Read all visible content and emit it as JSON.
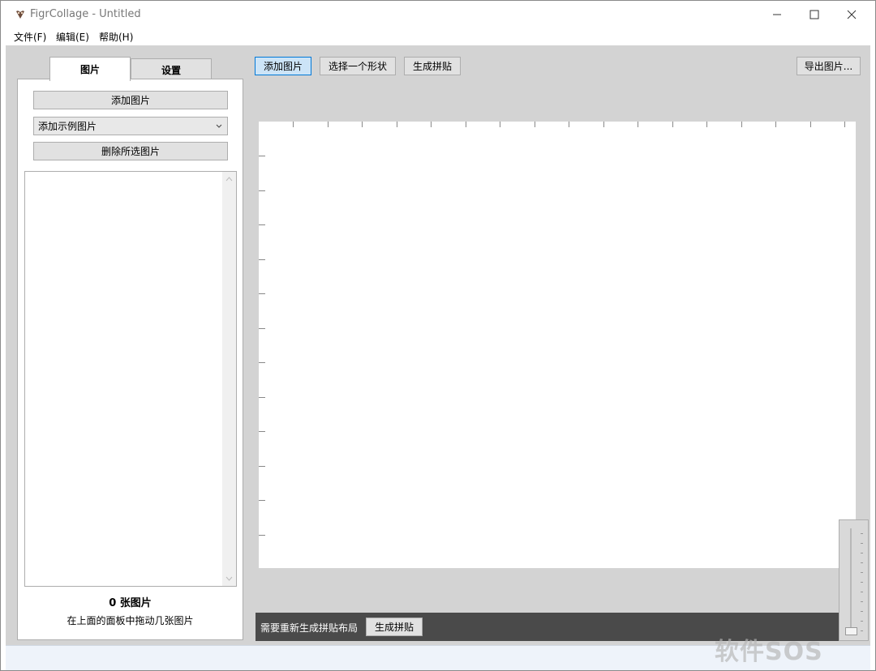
{
  "window": {
    "title": "FigrCollage - Untitled"
  },
  "menu": [
    {
      "label": "文件(F)"
    },
    {
      "label": "编辑(E)"
    },
    {
      "label": "帮助(H)"
    }
  ],
  "tabs": [
    {
      "label": "图片"
    },
    {
      "label": "设置"
    }
  ],
  "leftpanel": {
    "add_button": "添加图片",
    "sample_select": "添加示例图片",
    "delete_button": "删除所选图片",
    "count_label": "0 张图片",
    "hint": "在上面的面板中拖动几张图片"
  },
  "toolbar": {
    "add": "添加图片",
    "shape": "选择一个形状",
    "generate": "生成拼贴",
    "export": "导出图片..."
  },
  "status": {
    "message": "需要重新生成拼贴布局",
    "generate_button": "生成拼贴"
  },
  "watermark": "软件SOS"
}
